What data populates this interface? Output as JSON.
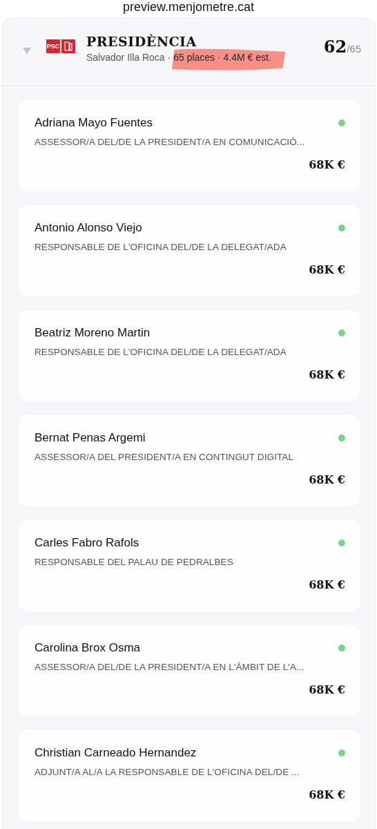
{
  "address_bar": {
    "url": "preview.menjometre.cat"
  },
  "group": {
    "expanded": true,
    "title": "PRESIDÈNCIA",
    "logo_text": "PSC",
    "subtitle_name": "Salvador Illa Roca",
    "subtitle_stats": "· 65 places · 4.4M € est.",
    "count": "62",
    "total": "/65"
  },
  "people": [
    {
      "name": "Adriana Mayo Fuentes",
      "role": "ASSESSOR/A DEL/DE LA PRESIDENT/A EN COMUNICACIÓ...",
      "salary": "68K €",
      "color": "#74d68a"
    },
    {
      "name": "Antonio Alonso Viejo",
      "role": "RESPONSABLE DE L'OFICINA DEL/DE LA DELEGAT/ADA",
      "salary": "68K €",
      "color": "#74d68a"
    },
    {
      "name": "Beatriz Moreno Martin",
      "role": "RESPONSABLE DE L'OFICINA DEL/DE LA DELEGAT/ADA",
      "salary": "68K €",
      "color": "#74d68a"
    },
    {
      "name": "Bernat Penas Argemi",
      "role": "ASSESSOR/A DEL PRESIDENT/A EN CONTINGUT DIGITAL",
      "salary": "68K €",
      "color": "#74d68a"
    },
    {
      "name": "Carles Fabro Rafols",
      "role": "RESPONSABLE DEL PALAU DE PEDRALBES",
      "salary": "68K €",
      "color": "#74d68a"
    },
    {
      "name": "Carolina Brox Osma",
      "role": "ASSESSOR/A DEL/DE LA PRESIDENT/A EN L'ÀMBIT DE L'A...",
      "salary": "68K €",
      "color": "#74d68a"
    },
    {
      "name": "Christian Carneado Hernandez",
      "role": "ADJUNT/A AL/A LA RESPONSABLE DE L'OFICINA DEL/DE ...",
      "salary": "68K €",
      "color": "#74d68a"
    }
  ]
}
